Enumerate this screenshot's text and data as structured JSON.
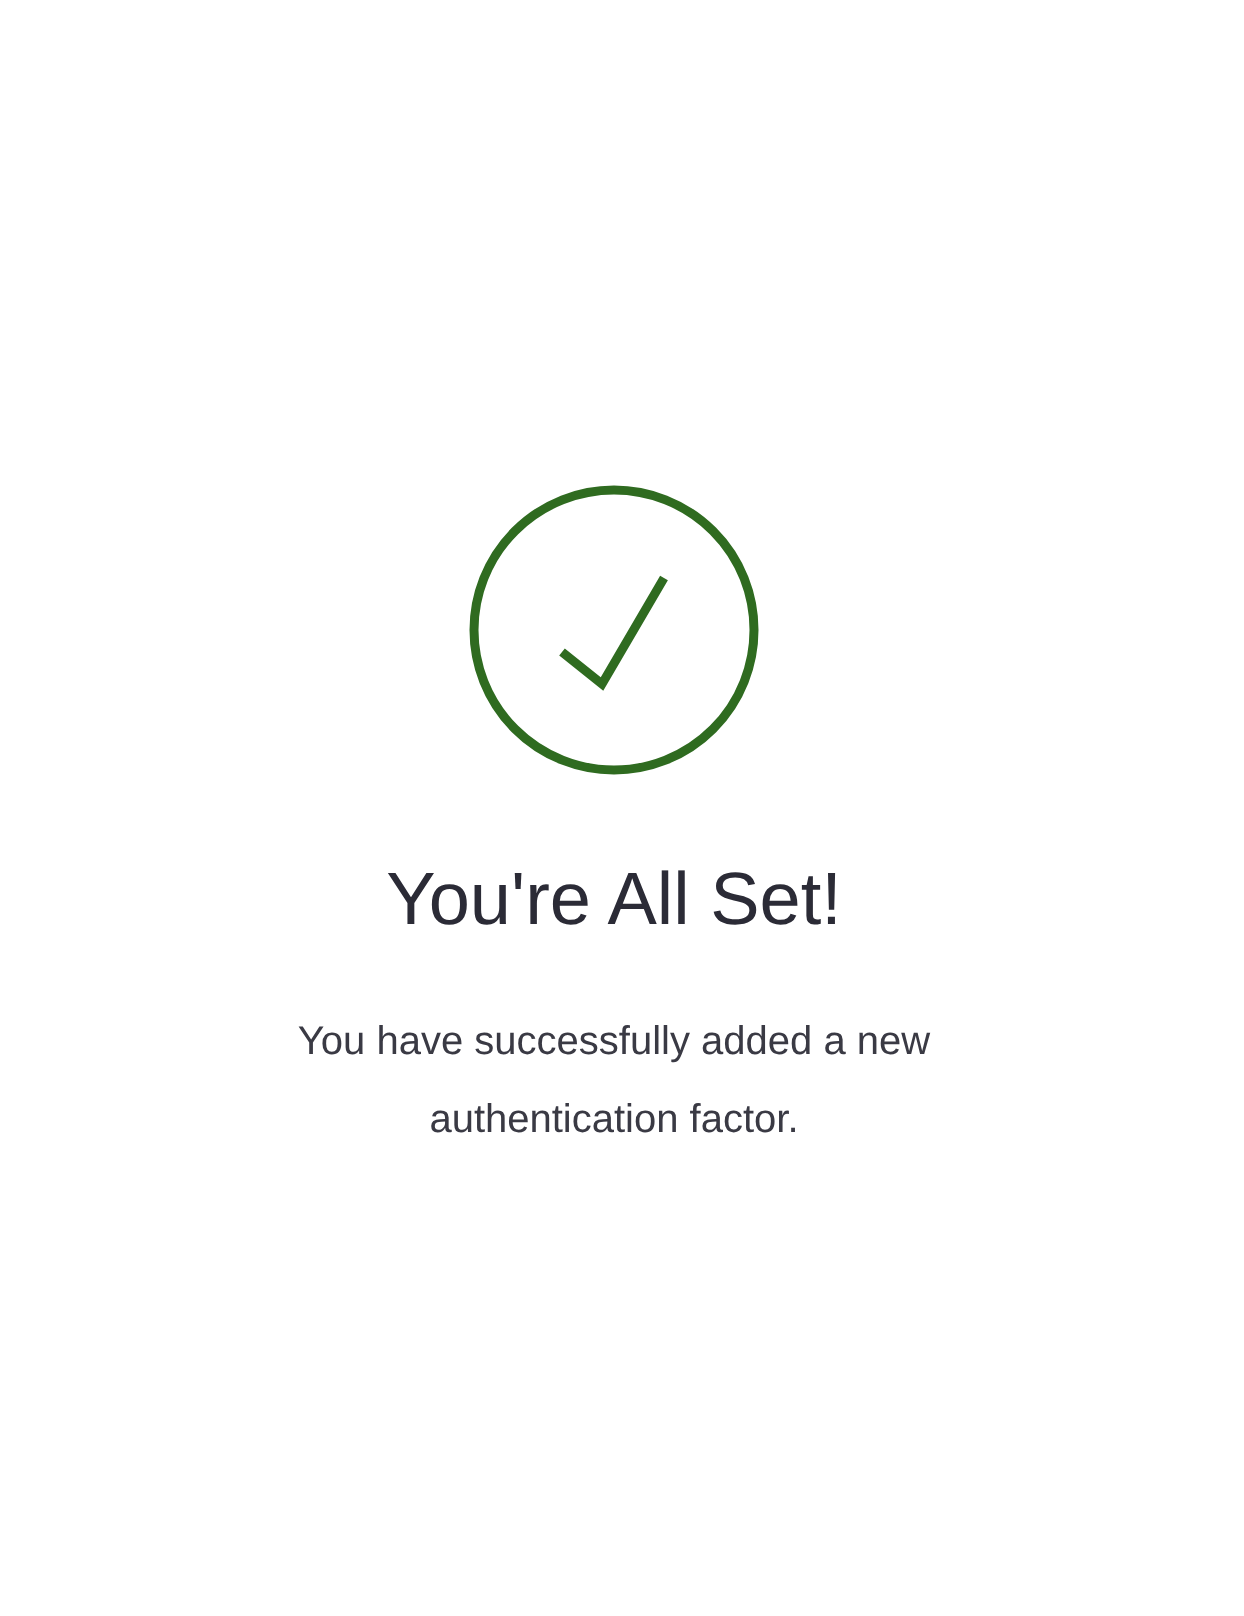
{
  "title": "You're All Set!",
  "message": "You have successfully added a new authentication factor."
}
